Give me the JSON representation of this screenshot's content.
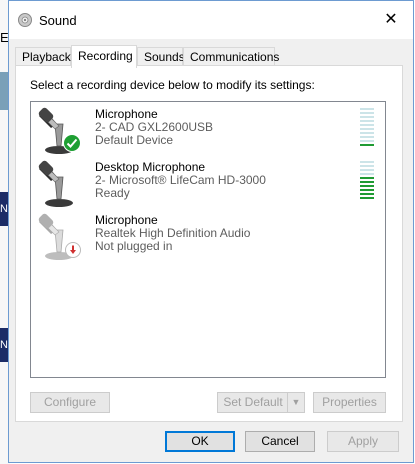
{
  "background": {
    "partial_letter": "E",
    "side_letter": "N"
  },
  "window": {
    "title": "Sound",
    "close_glyph": "✕"
  },
  "tabs": [
    {
      "label": "Playback",
      "active": false
    },
    {
      "label": "Recording",
      "active": true
    },
    {
      "label": "Sounds",
      "active": false
    },
    {
      "label": "Communications",
      "active": false
    }
  ],
  "instruction": "Select a recording device below to modify its settings:",
  "devices": [
    {
      "name": "Microphone",
      "detail": "2- CAD GXL2600USB",
      "status": "Default Device",
      "badge": "check",
      "level": 0.1
    },
    {
      "name": "Desktop Microphone",
      "detail": "2- Microsoft® LifeCam HD-3000",
      "status": "Ready",
      "badge": "none",
      "level": 0.6
    },
    {
      "name": "Microphone",
      "detail": "Realtek High Definition Audio",
      "status": "Not plugged in",
      "badge": "unplugged",
      "level": 0
    }
  ],
  "buttons": {
    "configure": "Configure",
    "set_default": "Set Default",
    "properties": "Properties",
    "ok": "OK",
    "cancel": "Cancel",
    "apply": "Apply"
  },
  "colors": {
    "accent": "#0078d7",
    "meter_on": "#1f9b33",
    "meter_off": "#cce4e8",
    "check": "#1e9f33",
    "unplugged": "#d03030"
  }
}
